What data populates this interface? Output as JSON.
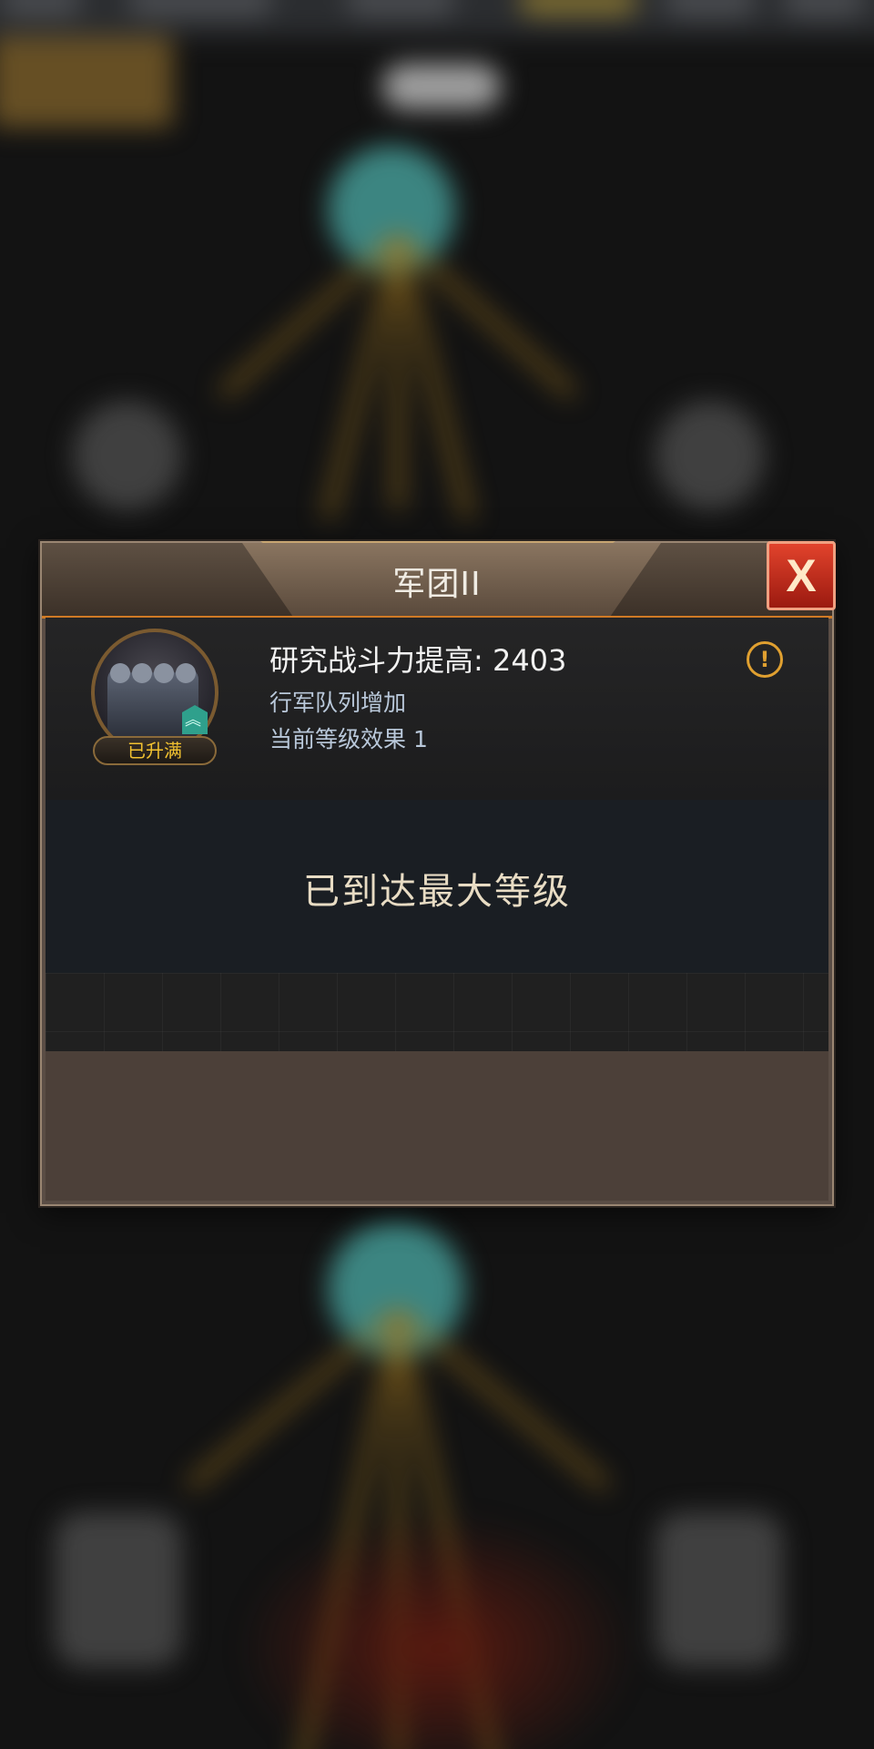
{
  "dialog": {
    "title": "军团II",
    "close_label": "X",
    "tech": {
      "maxed_label": "已升满",
      "stat_text": "研究战斗力提高: 2403",
      "effect_text": "行军队列增加",
      "level_text": "当前等级效果 1"
    },
    "info_icon": "!",
    "max_level_text": "已到达最大等级"
  },
  "colors": {
    "accent_orange": "#d07a25",
    "close_red": "#c8301c",
    "gold_text": "#f2c230"
  }
}
